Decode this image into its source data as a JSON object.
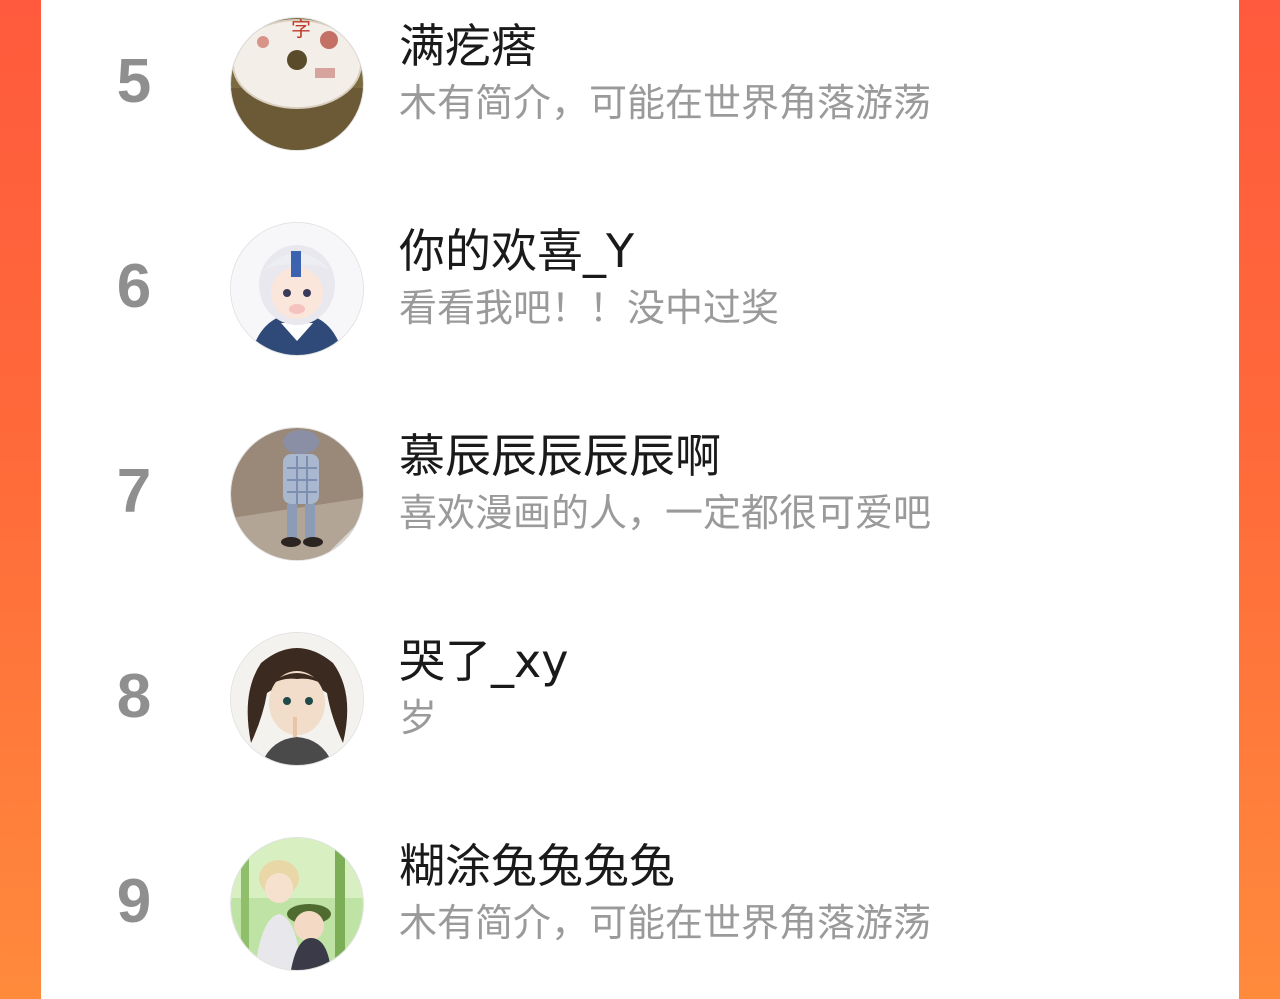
{
  "ranking": {
    "rows": [
      {
        "rank": "5",
        "name": "满疙瘩",
        "bio": "木有简介，可能在世界角落游荡"
      },
      {
        "rank": "6",
        "name": "你的欢喜_Y",
        "bio": "看看我吧！！没中过奖"
      },
      {
        "rank": "7",
        "name": "慕辰辰辰辰辰啊",
        "bio": "喜欢漫画的人，一定都很可爱吧"
      },
      {
        "rank": "8",
        "name": "哭了_xy",
        "bio": "岁"
      },
      {
        "rank": "9",
        "name": "糊涂兔兔兔兔",
        "bio": "木有简介，可能在世界角落游荡"
      }
    ]
  },
  "colors": {
    "background_gradient_top": "#ff5a3d",
    "background_gradient_bottom": "#ff8a3c",
    "panel": "#ffffff",
    "rank_text": "#8f8f8f",
    "name_text": "#1a1a1a",
    "bio_text": "#9a9a9a"
  }
}
